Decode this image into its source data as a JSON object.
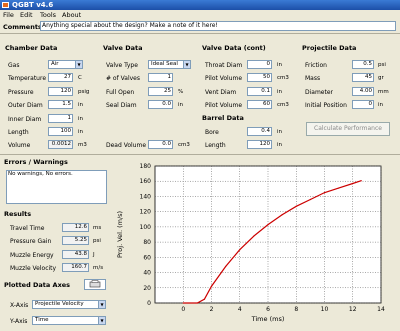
{
  "window": {
    "title": "QGBT v4.6"
  },
  "menu": [
    "File",
    "Edit",
    "Tools",
    "About"
  ],
  "comments": {
    "label": "Comments",
    "value": "Anything special about the design? Make a note of it here!"
  },
  "chamber": {
    "title": "Chamber Data",
    "rows": [
      {
        "label": "Gas",
        "value": "Air",
        "unit": ""
      },
      {
        "label": "Temperature",
        "value": "27",
        "unit": "C"
      },
      {
        "label": "Pressure",
        "value": "120",
        "unit": "psig"
      },
      {
        "label": "Outer Diam",
        "value": "1.5",
        "unit": "in"
      },
      {
        "label": "Inner Diam",
        "value": "1",
        "unit": "in"
      },
      {
        "label": "Length",
        "value": "100",
        "unit": "in"
      },
      {
        "label": "Volume",
        "value": "0.0012",
        "unit": "m3"
      }
    ]
  },
  "valve": {
    "title": "Valve Data",
    "rows": [
      {
        "label": "Valve Type",
        "value": "Ideal Seal"
      },
      {
        "label": "# of Valves",
        "value": "1"
      },
      {
        "label": "Full Open",
        "value": "25",
        "unit": "%"
      },
      {
        "label": "Seal Diam",
        "value": "0.0",
        "unit": "in"
      },
      {
        "label": "Dead Volume",
        "value": "0.0",
        "unit": "cm3"
      }
    ]
  },
  "valve_cont": {
    "title": "Valve Data (cont)",
    "rows": [
      {
        "label": "Throat Diam",
        "value": "0",
        "unit": "in"
      },
      {
        "label": "Pilot Volume",
        "value": "50",
        "unit": "cm3"
      },
      {
        "label": "Vent Diam",
        "value": "0.1",
        "unit": "in"
      },
      {
        "label": "Pilot Volume",
        "value": "60",
        "unit": "cm3"
      }
    ]
  },
  "barrel": {
    "title": "Barrel Data",
    "rows": [
      {
        "label": "Bore",
        "value": "0.4",
        "unit": "in"
      },
      {
        "label": "Length",
        "value": "120",
        "unit": "in"
      }
    ]
  },
  "projectile": {
    "title": "Projectile Data",
    "rows": [
      {
        "label": "Friction",
        "value": "0.5",
        "unit": "psi"
      },
      {
        "label": "Mass",
        "value": "45",
        "unit": "gr"
      },
      {
        "label": "Diameter",
        "value": "4.00",
        "unit": "mm"
      },
      {
        "label": "Initial Position",
        "value": "0",
        "unit": "in"
      }
    ],
    "button": "Calculate Performance"
  },
  "errors": {
    "title": "Errors / Warnings",
    "text": "No warnings, No errors."
  },
  "results": {
    "title": "Results",
    "rows": [
      {
        "label": "Travel Time",
        "value": "12.6",
        "unit": "ms"
      },
      {
        "label": "Pressure Gain",
        "value": "5.25",
        "unit": "psi"
      },
      {
        "label": "Muzzle Energy",
        "value": "43.8",
        "unit": "J"
      },
      {
        "label": "Muzzle Velocity",
        "value": "160.7",
        "unit": "m/s"
      }
    ]
  },
  "plot_axes": {
    "title": "Plotted Data Axes",
    "xaxis_label": "X-Axis",
    "xaxis_value": "Projectile Velocity",
    "yaxis_label": "Y-Axis",
    "yaxis_value": "Time"
  },
  "chart_data": {
    "type": "line",
    "xlabel": "Time (ms)",
    "ylabel": "Proj. Vel. (m/s)",
    "xlim": [
      -2,
      14
    ],
    "ylim": [
      0,
      180
    ],
    "xticks": [
      0,
      2,
      4,
      6,
      8,
      10,
      12,
      14
    ],
    "yticks": [
      0,
      20,
      40,
      60,
      80,
      100,
      120,
      140,
      160,
      180
    ],
    "grid": true,
    "x": [
      0.0,
      1.0,
      1.5,
      2.0,
      3.0,
      4.0,
      5.0,
      6.0,
      7.0,
      8.0,
      9.0,
      10.0,
      11.0,
      12.0,
      12.6
    ],
    "y": [
      0,
      0,
      5,
      22,
      48,
      70,
      88,
      103,
      116,
      127,
      136,
      145,
      151,
      157,
      160.7
    ],
    "color": "#cc0000"
  },
  "colors": {
    "title_bar": "#1c4fa8",
    "plot_line": "#cc0000",
    "plot_bg": "#ffffff"
  }
}
